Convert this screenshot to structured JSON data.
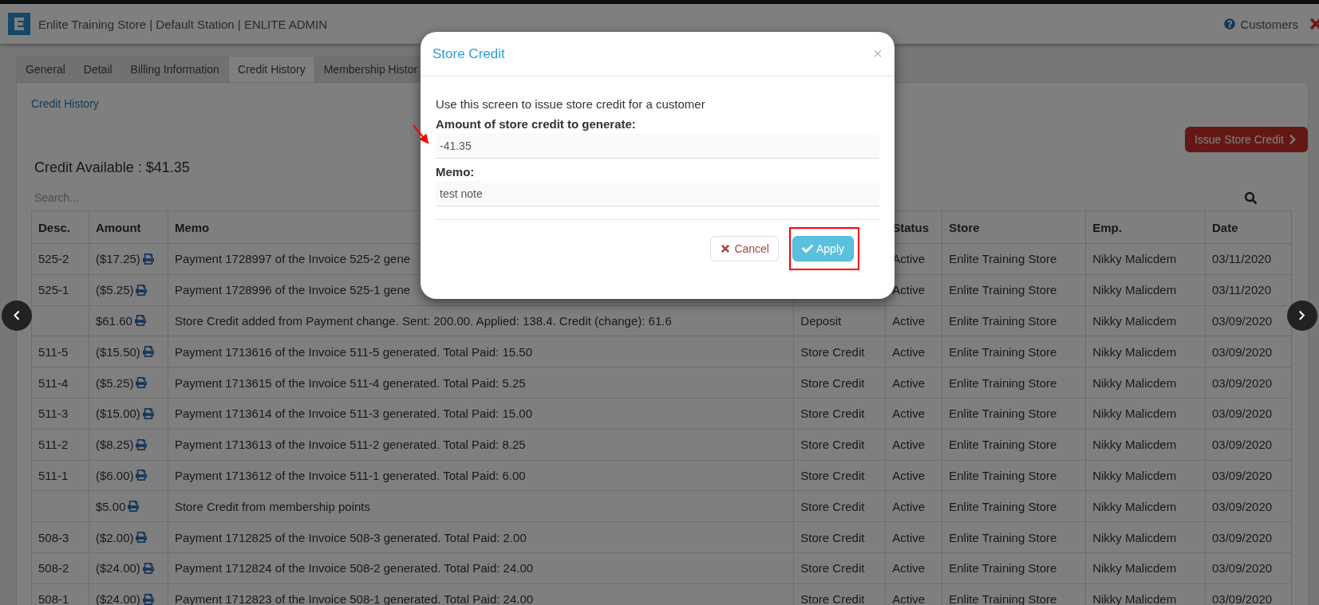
{
  "header": {
    "title": "Enlite Training Store | Default Station | ENLITE ADMIN",
    "section": "Customers"
  },
  "tabs": [
    {
      "label": "General",
      "selected": false
    },
    {
      "label": "Detail",
      "selected": false
    },
    {
      "label": "Billing Information",
      "selected": false
    },
    {
      "label": "Credit History",
      "selected": true
    },
    {
      "label": "Membership Histor",
      "selected": false
    }
  ],
  "breadcrumb": "Credit History",
  "issue_button": "Issue Store Credit",
  "credit_available": "Credit Available : $41.35",
  "search": {
    "placeholder": "Search..."
  },
  "table": {
    "columns": [
      {
        "label": "Desc."
      },
      {
        "label": "Amount"
      },
      {
        "label": "Memo"
      },
      {},
      {
        "label": "Status"
      },
      {
        "label": "Store"
      },
      {
        "label": "Emp."
      },
      {
        "label": "Date"
      }
    ],
    "rows": [
      {
        "desc": "525-2",
        "amount": "($17.25)",
        "memo": "Payment 1728997 of the Invoice 525-2 gene",
        "status": "Active",
        "store": "Enlite Training Store",
        "emp": "Nikky Malicdem",
        "date": "03/11/2020"
      },
      {
        "desc": "525-1",
        "amount": "($5.25)",
        "memo": "Payment 1728996 of the Invoice 525-1 gene",
        "status": "Active",
        "store": "Enlite Training Store",
        "emp": "Nikky Malicdem",
        "date": "03/11/2020"
      },
      {
        "amount": "$61.60",
        "memo": "Store Credit added from Payment change. Sent: 200.00. Applied: 138.4. Credit (change): 61.6",
        "type": "Deposit",
        "status": "Active",
        "store": "Enlite Training Store",
        "emp": "Nikky Malicdem",
        "date": "03/09/2020"
      },
      {
        "desc": "511-5",
        "amount": "($15.50)",
        "memo": "Payment 1713616 of the Invoice 511-5 generated. Total Paid: 15.50",
        "type": "Store Credit",
        "status": "Active",
        "store": "Enlite Training Store",
        "emp": "Nikky Malicdem",
        "date": "03/09/2020"
      },
      {
        "desc": "511-4",
        "amount": "($5.25)",
        "memo": "Payment 1713615 of the Invoice 511-4 generated. Total Paid: 5.25",
        "type": "Store Credit",
        "status": "Active",
        "store": "Enlite Training Store",
        "emp": "Nikky Malicdem",
        "date": "03/09/2020"
      },
      {
        "desc": "511-3",
        "amount": "($15.00)",
        "memo": "Payment 1713614 of the Invoice 511-3 generated. Total Paid: 15.00",
        "type": "Store Credit",
        "status": "Active",
        "store": "Enlite Training Store",
        "emp": "Nikky Malicdem",
        "date": "03/09/2020"
      },
      {
        "desc": "511-2",
        "amount": "($8.25)",
        "memo": "Payment 1713613 of the Invoice 511-2 generated. Total Paid: 8.25",
        "type": "Store Credit",
        "status": "Active",
        "store": "Enlite Training Store",
        "emp": "Nikky Malicdem",
        "date": "03/09/2020"
      },
      {
        "desc": "511-1",
        "amount": "($6.00)",
        "memo": "Payment 1713612 of the Invoice 511-1 generated. Total Paid: 6.00",
        "type": "Store Credit",
        "status": "Active",
        "store": "Enlite Training Store",
        "emp": "Nikky Malicdem",
        "date": "03/09/2020"
      },
      {
        "amount": "$5.00",
        "memo": "Store Credit from membership points",
        "type": "Store Credit",
        "status": "Active",
        "store": "Enlite Training Store",
        "emp": "Nikky Malicdem",
        "date": "03/09/2020"
      },
      {
        "desc": "508-3",
        "amount": "($2.00)",
        "memo": "Payment 1712825 of the Invoice 508-3 generated. Total Paid: 2.00",
        "type": "Store Credit",
        "status": "Active",
        "store": "Enlite Training Store",
        "emp": "Nikky Malicdem",
        "date": "03/09/2020"
      },
      {
        "desc": "508-2",
        "amount": "($24.00)",
        "memo": "Payment 1712824 of the Invoice 508-2 generated. Total Paid: 24.00",
        "type": "Store Credit",
        "status": "Active",
        "store": "Enlite Training Store",
        "emp": "Nikky Malicdem",
        "date": "03/09/2020"
      },
      {
        "desc": "508-1",
        "amount": "($24.00)",
        "memo": "Payment 1712823 of the Invoice 508-1 generated. Total Paid: 24.00",
        "type": "Store Credit",
        "status": "Active",
        "store": "Enlite Training Store",
        "emp": "Nikky Malicdem",
        "date": "03/09/2020"
      }
    ]
  },
  "modal": {
    "title": "Store Credit",
    "close": "×",
    "intro": "Use this screen to issue store credit for a customer",
    "amount_label": "Amount of store credit to generate:",
    "amount_value": "-41.35",
    "amount_pointed": true,
    "memo_label": "Memo:",
    "memo_value": "test note",
    "buttons": [
      {
        "kind": "cancel",
        "label": "Cancel",
        "highlighted": false
      },
      {
        "kind": "apply",
        "label": "Apply",
        "highlighted": true
      }
    ]
  }
}
